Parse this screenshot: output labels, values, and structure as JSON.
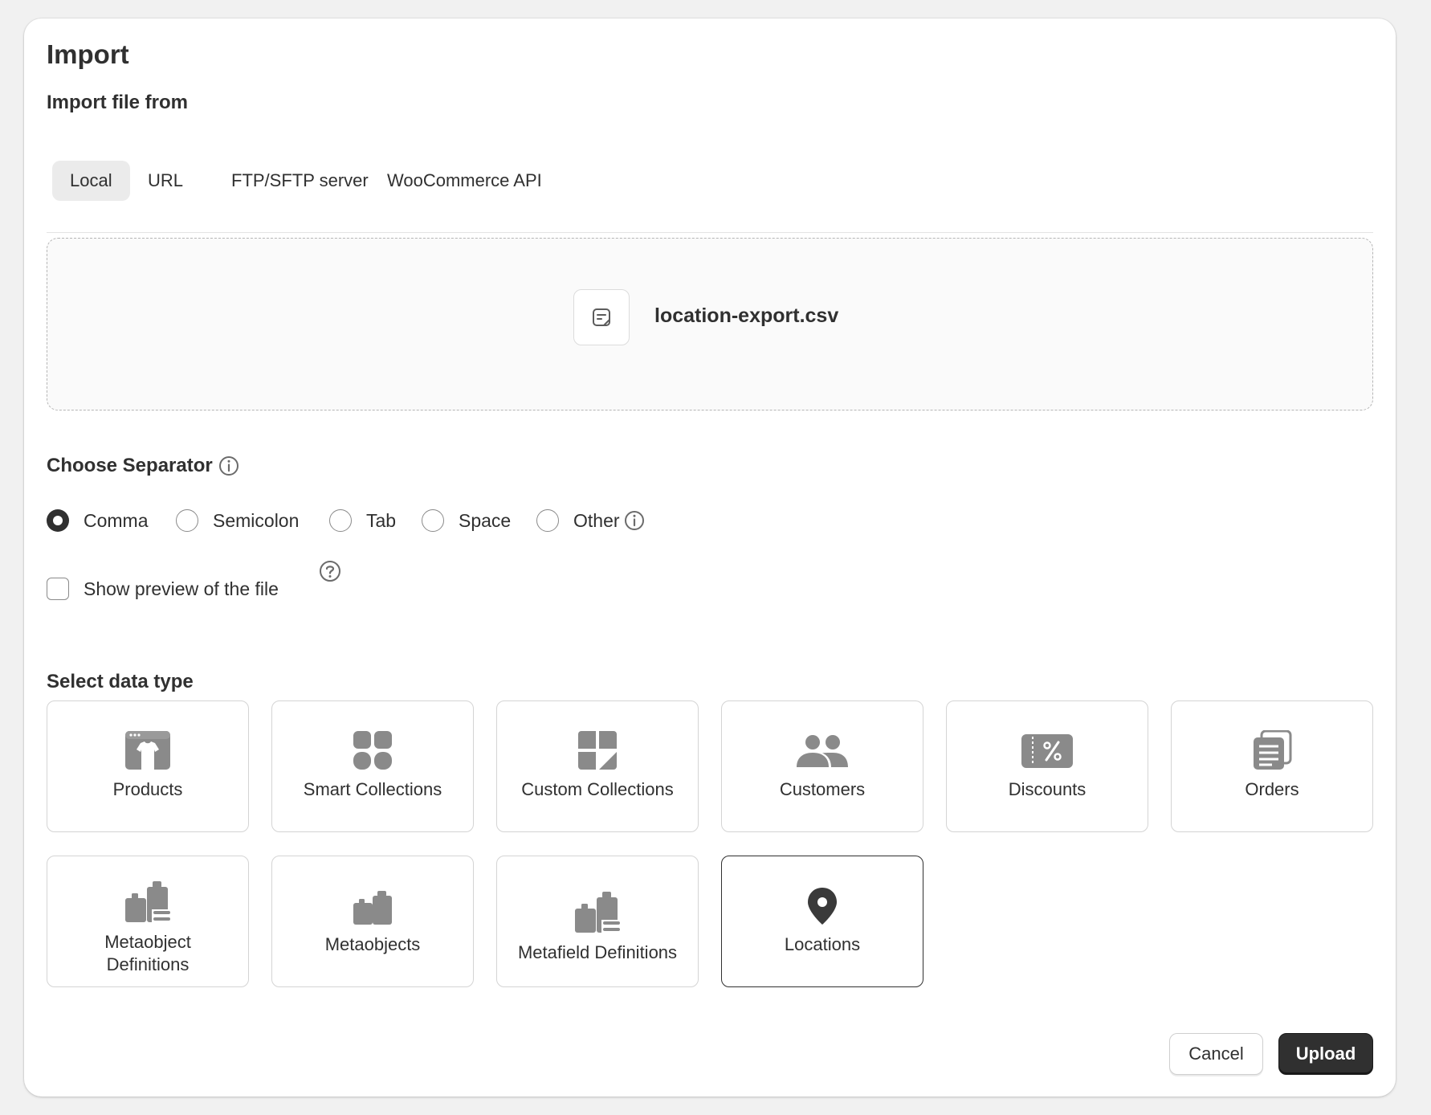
{
  "page": {
    "title": "Import"
  },
  "source": {
    "heading": "Import file from",
    "tabs": [
      {
        "label": "Local",
        "active": true
      },
      {
        "label": "URL",
        "active": false
      },
      {
        "label": "FTP/SFTP server",
        "active": false
      },
      {
        "label": "WooCommerce API",
        "active": false
      }
    ]
  },
  "file": {
    "name": "location-export.csv",
    "icon": "file-icon"
  },
  "separator": {
    "heading": "Choose Separator",
    "options": [
      {
        "label": "Comma",
        "checked": true
      },
      {
        "label": "Semicolon",
        "checked": false
      },
      {
        "label": "Tab",
        "checked": false
      },
      {
        "label": "Space",
        "checked": false
      },
      {
        "label": "Other",
        "checked": false
      }
    ]
  },
  "preview": {
    "label": "Show preview of the file",
    "checked": false
  },
  "data_type": {
    "heading": "Select data type",
    "selected": "Locations",
    "tiles": [
      {
        "label": "Products",
        "icon": "product-icon"
      },
      {
        "label": "Smart Collections",
        "icon": "smart-collection-icon"
      },
      {
        "label": "Custom Collections",
        "icon": "custom-collection-icon"
      },
      {
        "label": "Customers",
        "icon": "customers-icon"
      },
      {
        "label": "Discounts",
        "icon": "discount-icon"
      },
      {
        "label": "Orders",
        "icon": "orders-icon"
      },
      {
        "label": "Metaobject Definitions",
        "label_line1": "Metaobject",
        "label_line2": "Definitions",
        "icon": "metaobject-definitions-icon"
      },
      {
        "label": "Metaobjects",
        "icon": "metaobjects-icon"
      },
      {
        "label": "Metafield Definitions",
        "icon": "metafield-definitions-icon"
      },
      {
        "label": "Locations",
        "icon": "location-pin-icon"
      }
    ]
  },
  "actions": {
    "cancel": "Cancel",
    "upload": "Upload"
  },
  "colors": {
    "icon_gray": "#8a8a8a",
    "text": "#303030",
    "primary_button": "#303030"
  }
}
